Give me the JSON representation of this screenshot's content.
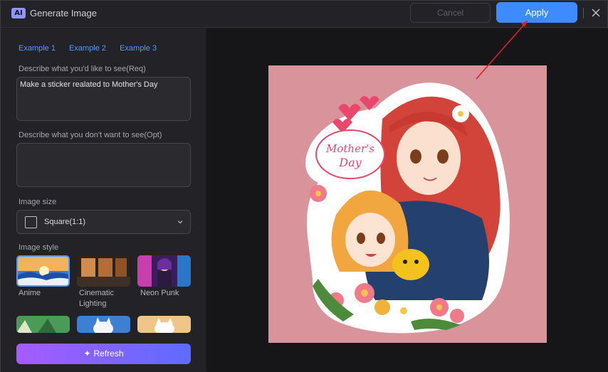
{
  "window": {
    "title": "Generate Image",
    "badge": "AI"
  },
  "header": {
    "cancel_label": "Cancel",
    "apply_label": "Apply"
  },
  "examples": [
    "Example 1",
    "Example 2",
    "Example 3"
  ],
  "prompt": {
    "label": "Describe what you'd like to see(Req)",
    "value": "Make a sticker realated to Mother's Day"
  },
  "negative_prompt": {
    "label": "Describe what you don't want to see(Opt)",
    "value": ""
  },
  "image_size": {
    "label": "Image size",
    "selected": "Square(1:1)"
  },
  "image_style": {
    "label": "Image style",
    "options": [
      {
        "label": "Anime",
        "selected": true
      },
      {
        "label": "Cinematic Lighting",
        "line1": "Cinematic",
        "line2": "Lighting",
        "selected": false
      },
      {
        "label": "Neon Punk",
        "selected": false
      }
    ]
  },
  "refresh_label": "Refresh",
  "preview": {
    "sticker_text_1": "Mother's",
    "sticker_text_2": "Day"
  },
  "colors": {
    "accent": "#3d8bff",
    "link": "#4d9bff",
    "canvas_bg": "#d9939a"
  }
}
